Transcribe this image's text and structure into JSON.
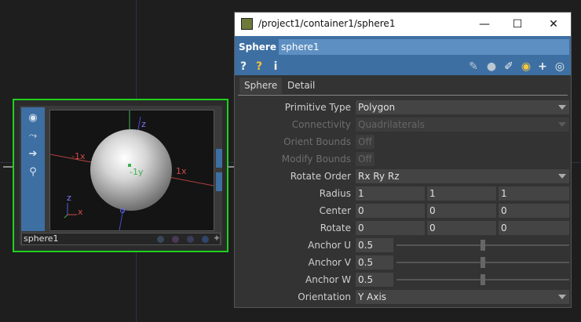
{
  "node": {
    "name": "sphere1",
    "viewport": {
      "axis_labels": {
        "z_top": "z",
        "neg_x": "-1x",
        "pos_x": "1x",
        "neg_y": "-1y",
        "gizmo_z": "z",
        "gizmo_x": "x"
      }
    }
  },
  "window": {
    "title": "/project1/container1/sphere1",
    "op_type": "Sphere",
    "op_name": "sphere1",
    "toolbar": {
      "help": "?",
      "info": "i",
      "add": "+"
    },
    "tabs": [
      {
        "label": "Sphere"
      },
      {
        "label": "Detail"
      }
    ],
    "params": {
      "primitive_type": {
        "label": "Primitive Type",
        "value": "Polygon"
      },
      "connectivity": {
        "label": "Connectivity",
        "value": "Quadrilaterals"
      },
      "orient_bounds": {
        "label": "Orient Bounds",
        "value": "Off"
      },
      "modify_bounds": {
        "label": "Modify Bounds",
        "value": "Off"
      },
      "rotate_order": {
        "label": "Rotate Order",
        "value": "Rx Ry Rz"
      },
      "radius": {
        "label": "Radius",
        "values": [
          "1",
          "1",
          "1"
        ]
      },
      "center": {
        "label": "Center",
        "values": [
          "0",
          "0",
          "0"
        ]
      },
      "rotate": {
        "label": "Rotate",
        "values": [
          "0",
          "0",
          "0"
        ]
      },
      "anchor_u": {
        "label": "Anchor U",
        "value": "0.5",
        "level": 0.5
      },
      "anchor_v": {
        "label": "Anchor V",
        "value": "0.5",
        "level": 0.5
      },
      "anchor_w": {
        "label": "Anchor W",
        "value": "0.5",
        "level": 0.5
      },
      "orientation": {
        "label": "Orientation",
        "value": "Y Axis"
      }
    }
  },
  "colors": {
    "node_border": "#1fd11f",
    "accent": "#3d6fa3",
    "op_name_field": "#5e8fc2"
  }
}
